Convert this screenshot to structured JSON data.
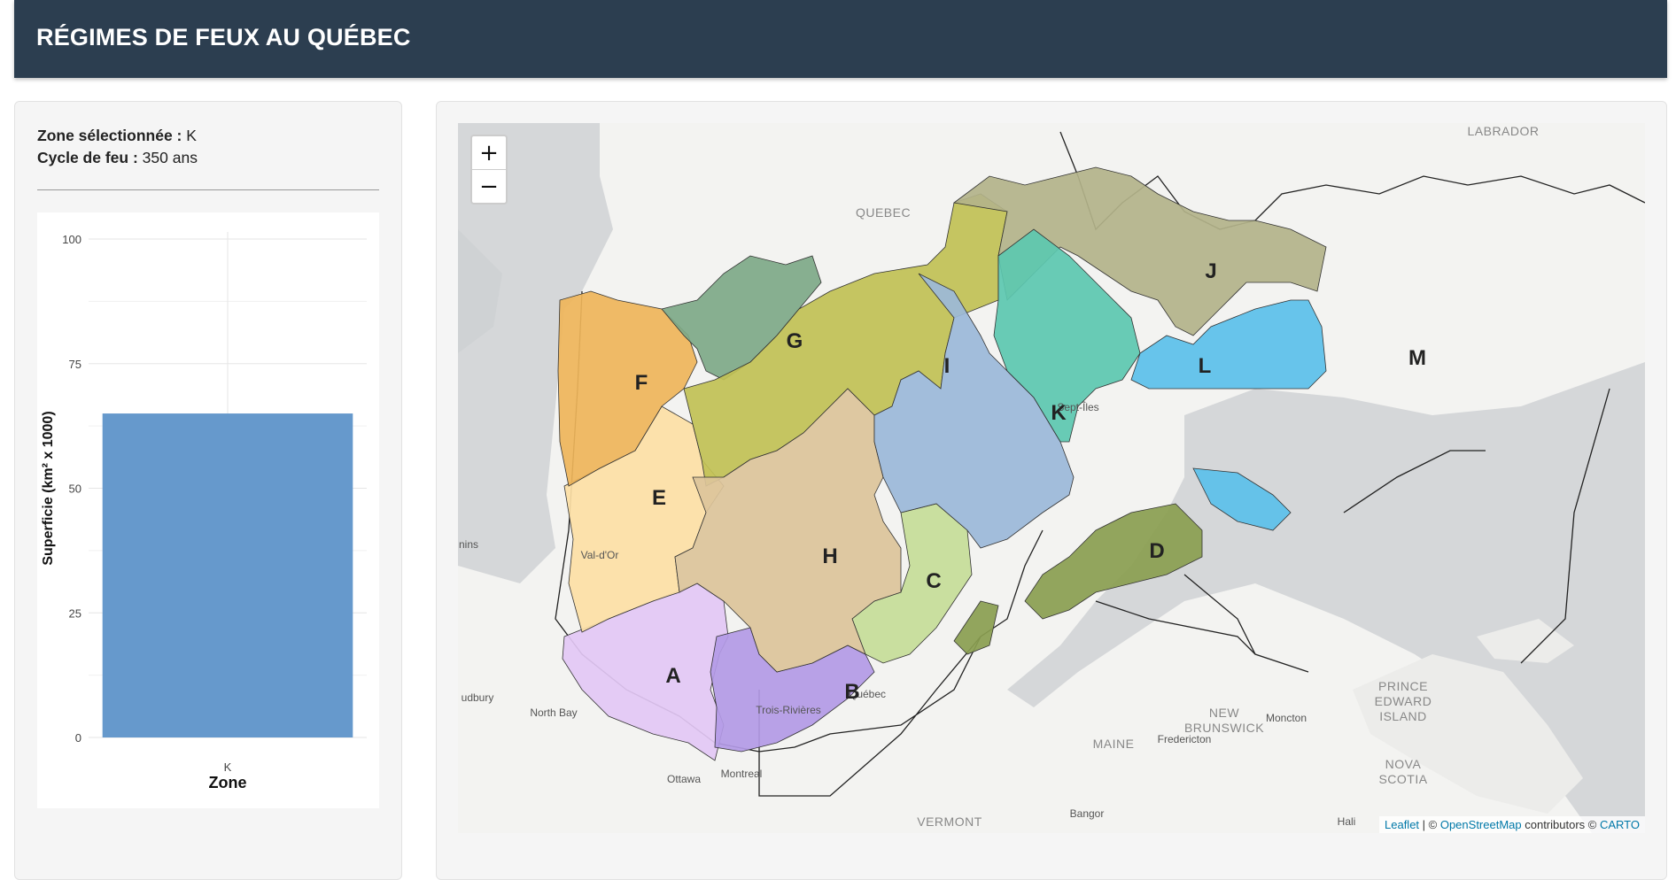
{
  "header": {
    "title": "RÉGIMES DE FEUX AU QUÉBEC"
  },
  "info": {
    "zone_label": "Zone sélectionnée :",
    "zone_value": "K",
    "cycle_label": "Cycle de feu :",
    "cycle_value": "350 ans"
  },
  "chart_data": {
    "type": "bar",
    "categories": [
      "K"
    ],
    "values": [
      65
    ],
    "xlabel": "Zone",
    "ylabel": "Superficie (km² x 1000)",
    "ylim": [
      0,
      100
    ],
    "yticks": [
      0,
      25,
      50,
      75,
      100
    ],
    "bar_color": "#6699cc",
    "grid": true
  },
  "map": {
    "zoom_in": "+",
    "zoom_out": "−",
    "zones": [
      {
        "id": "A",
        "color": "#e3c8f5"
      },
      {
        "id": "B",
        "color": "#b39ae6"
      },
      {
        "id": "C",
        "color": "#c5dd98"
      },
      {
        "id": "D",
        "color": "#8a9e50"
      },
      {
        "id": "E",
        "color": "#fde0a5"
      },
      {
        "id": "F",
        "color": "#efb55a"
      },
      {
        "id": "G",
        "color": "#7ea988"
      },
      {
        "id": "H",
        "color": "#dcc49a"
      },
      {
        "id": "I",
        "color": "#c1c155"
      },
      {
        "id": "J",
        "color": "#b3b38a"
      },
      {
        "id": "K",
        "color": "#9bb8d9"
      },
      {
        "id": "L",
        "color": "#5cc8b0"
      },
      {
        "id": "M",
        "color": "#5bc0ea"
      }
    ],
    "place_labels": [
      "LABRADOR",
      "QUEBEC",
      "NEW BRUNSWICK",
      "MAINE",
      "VERMONT",
      "PRINCE EDWARD ISLAND",
      "NOVA SCOTIA"
    ],
    "city_labels": [
      "Sept-Îles",
      "Val-d'Or",
      "Trois-Rivières",
      "Québec",
      "Montreal",
      "Ottawa",
      "North Bay",
      "udbury",
      "nins",
      "Fredericton",
      "Moncton",
      "Bangor",
      "Hali"
    ],
    "attribution": {
      "leaflet": "Leaflet",
      "sep": " | © ",
      "osm": "OpenStreetMap",
      "contrib": " contributors © ",
      "carto": "CARTO"
    }
  }
}
